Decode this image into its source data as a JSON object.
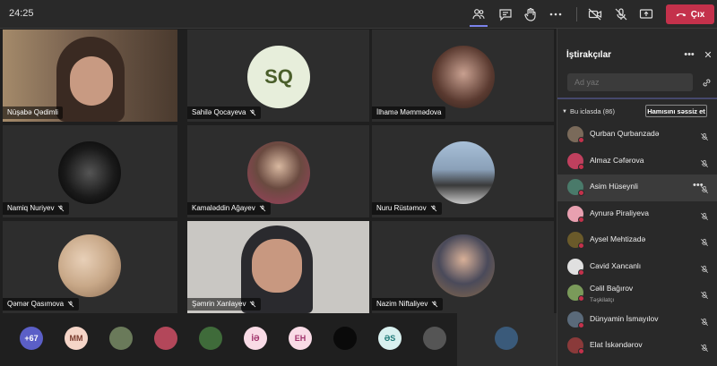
{
  "topbar": {
    "timer": "24:25",
    "leave_label": "Çıx"
  },
  "tiles": [
    {
      "name": "Nüşabə Qədimli"
    },
    {
      "name": "Sahilə Qocayeva",
      "initials": "SQ"
    },
    {
      "name": "İlhamə Məmmədova"
    },
    {
      "name": "Namiq Nuriyev"
    },
    {
      "name": "Kamaləddin Ağayev"
    },
    {
      "name": "Nuru Rüstəmov"
    },
    {
      "name": "Qəmər Qasımova"
    },
    {
      "name": "Şəmrin Xanlayev"
    },
    {
      "name": "Nazim Niftaliyev"
    }
  ],
  "strip": [
    {
      "label": "+67",
      "color": "#5b5fc7"
    },
    {
      "label": "MM",
      "color": "#f5d5c8",
      "fg": "#7a3b2e"
    },
    {
      "label": "",
      "color": "#6a7a5a"
    },
    {
      "label": "",
      "color": "#b3475a"
    },
    {
      "label": "",
      "color": "#3f6b3a"
    },
    {
      "label": "İƏ",
      "color": "#f9dbe6",
      "fg": "#a0336b"
    },
    {
      "label": "EH",
      "color": "#f9dbe6",
      "fg": "#a0336b"
    },
    {
      "label": "",
      "color": "#0a0a0a"
    },
    {
      "label": "ƏS",
      "color": "#d8f0ef",
      "fg": "#1f7a78"
    },
    {
      "label": "",
      "color": "#555"
    },
    {
      "label": "",
      "color": "#3a5a7a"
    }
  ],
  "panel": {
    "title": "İştirakçılar",
    "search_placeholder": "Ad yaz",
    "section_label": "Bu iclasda (86)",
    "mute_all_label": "Hamısını səssiz et",
    "people": [
      {
        "name": "Qurban Qurbanzadə",
        "color": "#7a6a5a"
      },
      {
        "name": "Almaz Cəfərova",
        "color": "#c0405e"
      },
      {
        "name": "Asim Hüseynli",
        "color": "#4a7a6a"
      },
      {
        "name": "Aynurə Piraliyeva",
        "color": "#e8a0b0"
      },
      {
        "name": "Aysel Mehtizadə",
        "color": "#6a5a2a"
      },
      {
        "name": "Cavid Xancanlı",
        "color": "#e0e0e0"
      },
      {
        "name": "Cəlil Bağırov",
        "role": "Təşkilatçı",
        "color": "#7a9a5a"
      },
      {
        "name": "Dünyamin İsmayılov",
        "color": "#5a6a7a"
      },
      {
        "name": "Elat İskəndərov",
        "color": "#8a3a3a"
      }
    ]
  }
}
